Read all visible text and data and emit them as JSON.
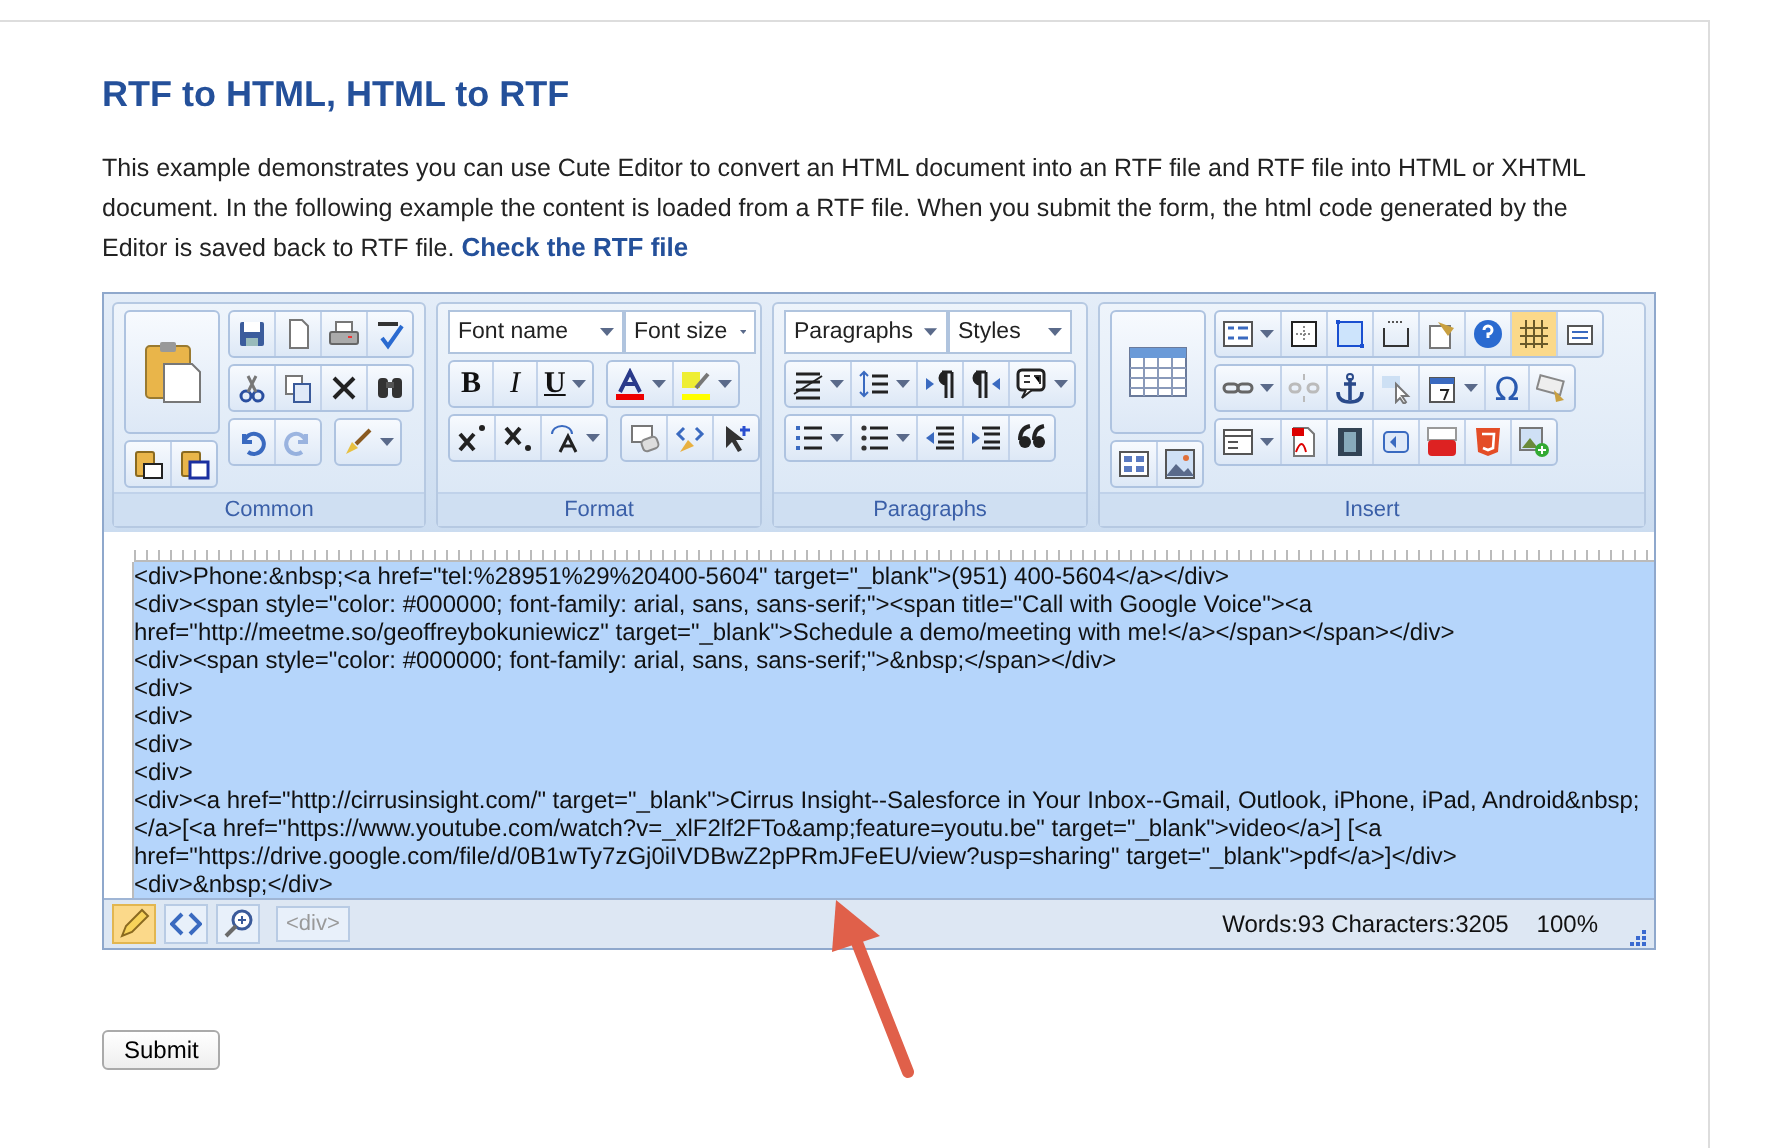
{
  "page": {
    "title": "RTF to HTML, HTML to RTF",
    "intro": "This example demonstrates you can use Cute Editor to convert an HTML document into an RTF file and RTF file into HTML or XHTML document. In the following example the content is loaded from a RTF file. When you submit the form, the html code generated by the Editor is saved back to RTF file.",
    "intro_link": "Check the RTF file"
  },
  "toolbar": {
    "groups": [
      {
        "label": "Common"
      },
      {
        "label": "Format"
      },
      {
        "label": "Paragraphs"
      },
      {
        "label": "Insert"
      }
    ],
    "font_name": "Font name",
    "font_size": "Font size",
    "paragraphs": "Paragraphs",
    "styles": "Styles",
    "bold": "B",
    "italic": "I",
    "underline": "U",
    "symbol": "Ω",
    "show_borders_on": true,
    "redo_disabled": true
  },
  "editor": {
    "content_selected": true,
    "lines": [
      "<div>Phone:&nbsp;<a href=\"tel:%28951%29%20400-5604\" target=\"_blank\">(951) 400-5604</a></div>",
      "<div><span style=\"color: #000000; font-family: arial, sans, sans-serif;\"><span title=\"Call with Google Voice\"><a",
      "href=\"http://meetme.so/geoffreybokuniewicz\" target=\"_blank\">Schedule a demo/meeting with me!</a></span></span></div>",
      "<div><span style=\"color: #000000; font-family: arial, sans, sans-serif;\">&nbsp;</span></div>",
      "<div>",
      "<div>",
      "<div>",
      "<div>",
      "<div><a href=\"http://cirrusinsight.com/\" target=\"_blank\">Cirrus Insight--Salesforce in Your Inbox--Gmail, Outlook, iPhone, iPad, Android&nbsp;",
      "</a>[<a href=\"https://www.youtube.com/watch?v=_xlF2lf2FTo&amp;feature=youtu.be\" target=\"_blank\">video</a>] [<a",
      "href=\"https://drive.google.com/file/d/0B1wTy7zGj0iIVDBwZ2pPRmJFeEU/view?usp=sharing\" target=\"_blank\">pdf</a>]</div>",
      "<div>&nbsp;</div>"
    ]
  },
  "status_bar": {
    "modes": [
      {
        "kind": "design",
        "selected": true
      },
      {
        "kind": "code",
        "selected": false
      },
      {
        "kind": "preview",
        "selected": false
      }
    ],
    "tag": "<div>",
    "counts": "Words:93 Characters:3205",
    "zoom": "100%"
  },
  "submit": "Submit"
}
